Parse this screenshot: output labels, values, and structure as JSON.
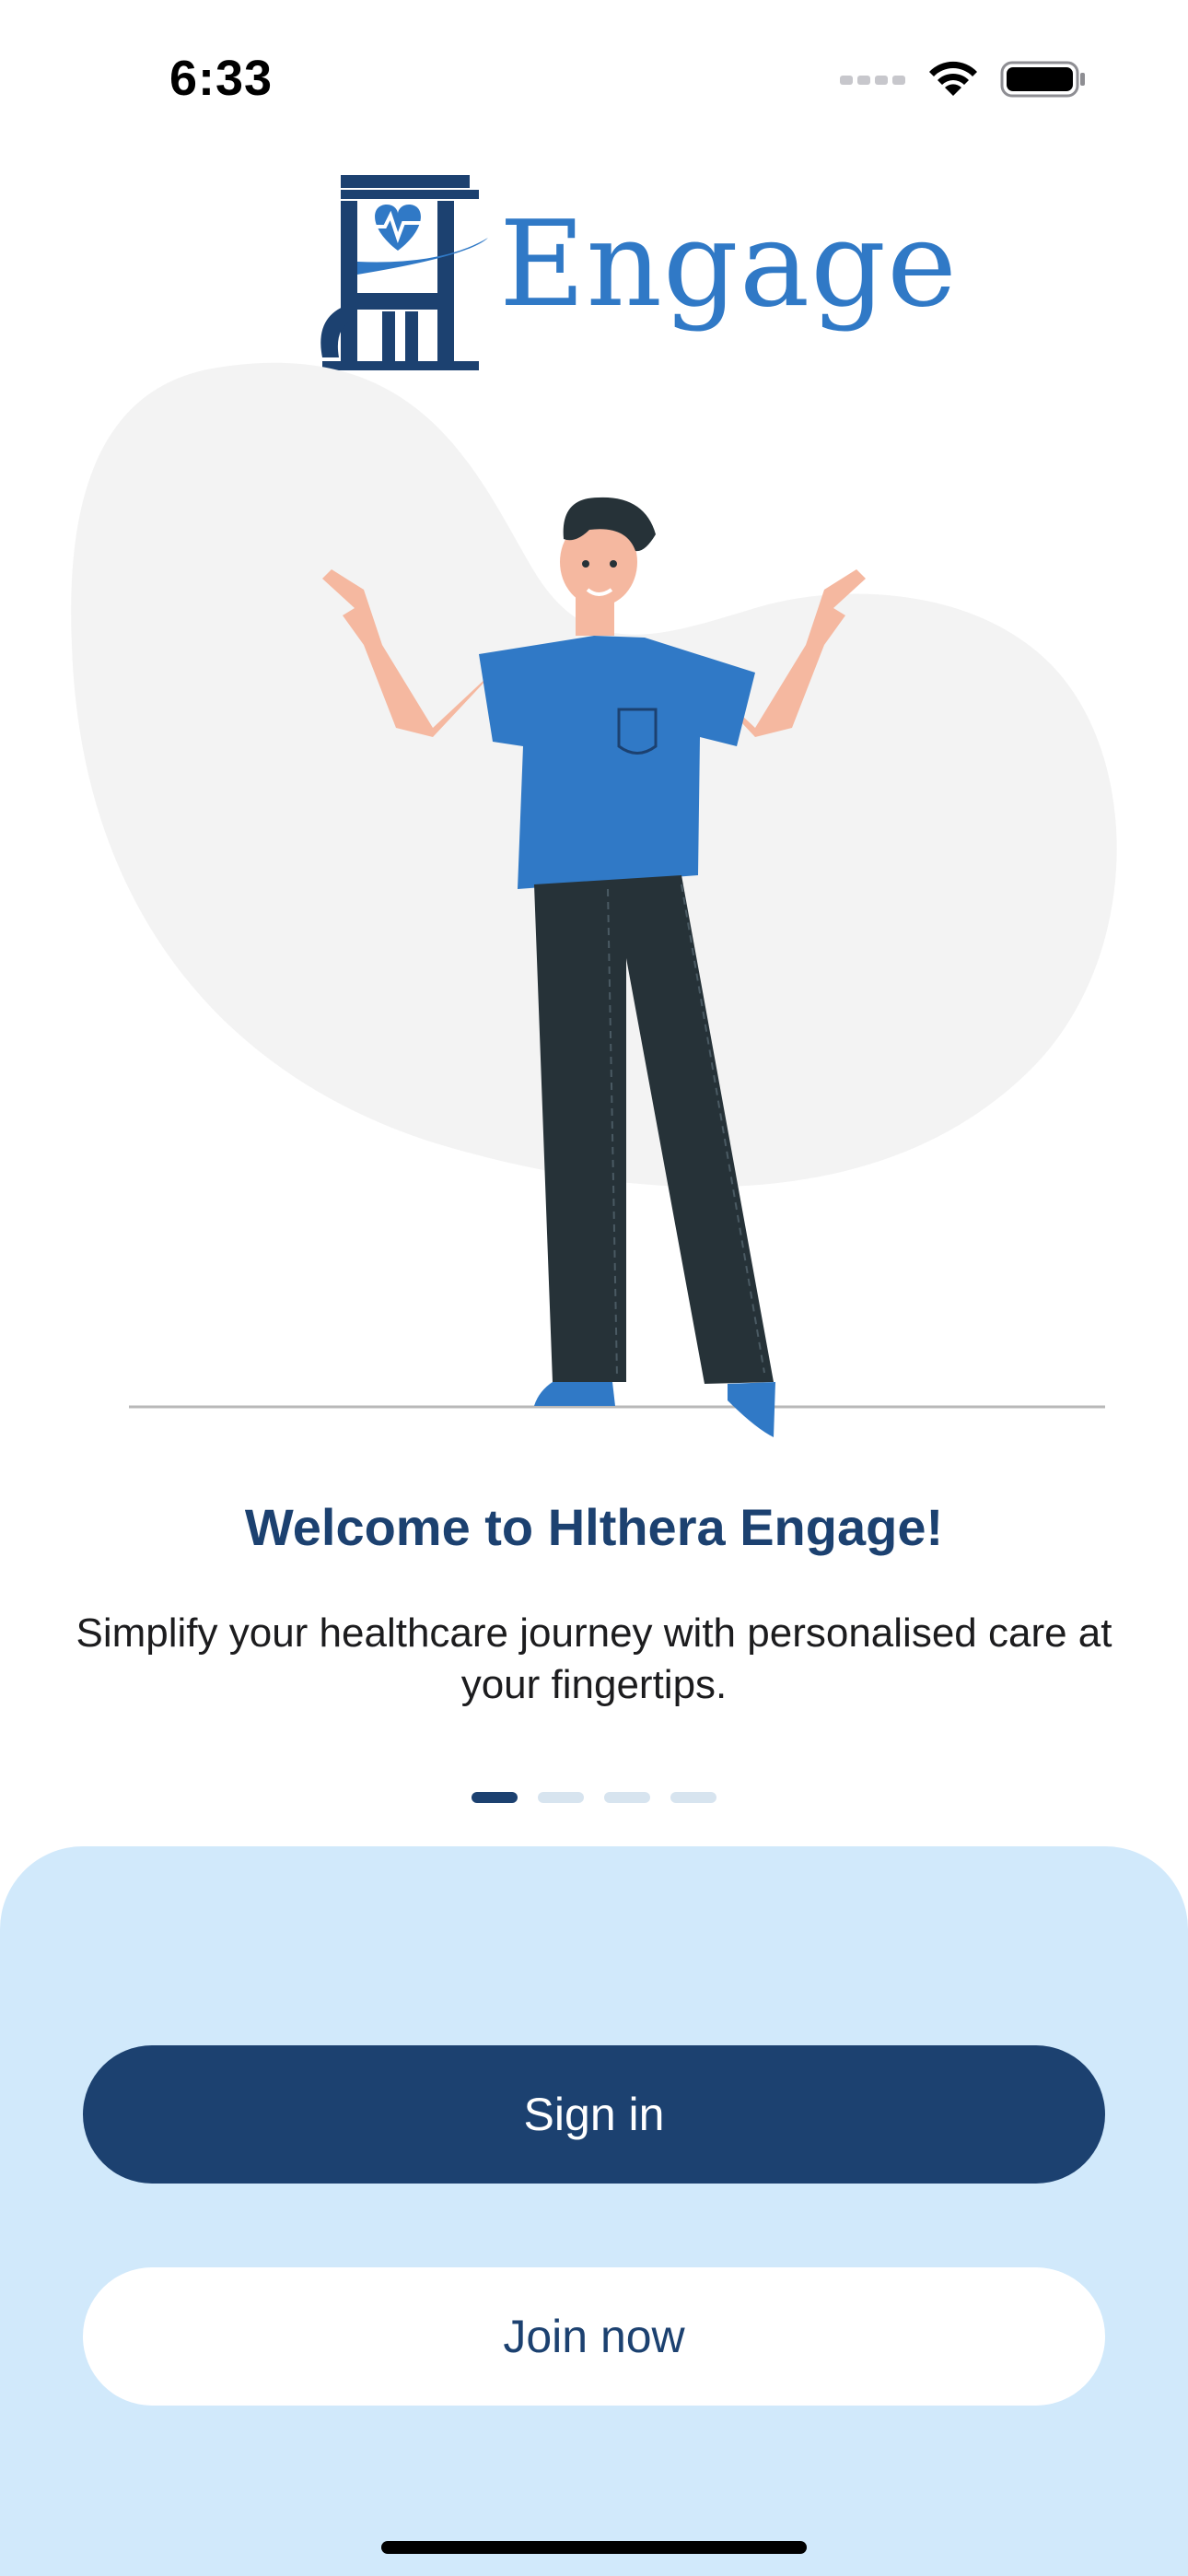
{
  "status_bar": {
    "time": "6:33",
    "icons": [
      "cellular-signal-icon",
      "wifi-icon",
      "battery-icon"
    ]
  },
  "logo": {
    "text": "Engage",
    "color": "#3079c6",
    "mark_color": "#1c4170"
  },
  "onboarding": {
    "title": "Welcome to Hlthera Engage!",
    "subtitle": "Simplify your healthcare journey with personalised care at your fingertips.",
    "pages_total": 4,
    "active_page": 1
  },
  "actions": {
    "sign_in_label": "Sign in",
    "join_now_label": "Join now"
  },
  "colors": {
    "primary": "#1c4170",
    "accent": "#3079c6",
    "panel_background": "#d1e9fb"
  }
}
